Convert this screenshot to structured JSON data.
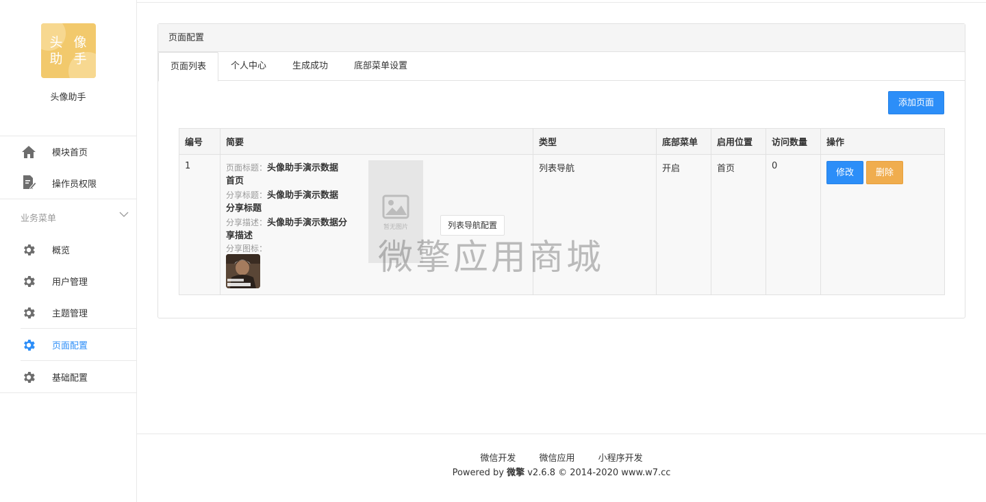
{
  "sidebar": {
    "logo_line1": "头 像",
    "logo_line2": "助 手",
    "app_name": "头像助手",
    "top_items": [
      {
        "label": "模块首页",
        "icon": "home-icon"
      },
      {
        "label": "操作员权限",
        "icon": "document-edit-icon"
      }
    ],
    "group_title": "业务菜单",
    "group_items": [
      {
        "label": "概览",
        "icon": "gear-icon"
      },
      {
        "label": "用户管理",
        "icon": "gear-icon"
      },
      {
        "label": "主题管理",
        "icon": "gear-icon"
      },
      {
        "label": "页面配置",
        "icon": "gear-icon",
        "active": true
      },
      {
        "label": "基础配置",
        "icon": "gear-icon"
      }
    ]
  },
  "panel": {
    "title": "页面配置",
    "tabs": [
      "页面列表",
      "个人中心",
      "生成成功",
      "底部菜单设置"
    ],
    "active_tab": 0,
    "add_button": "添加页面"
  },
  "table": {
    "headers": [
      "编号",
      "简要",
      "类型",
      "底部菜单",
      "启用位置",
      "访问数量",
      "操作"
    ],
    "rows": [
      {
        "id": "1",
        "summary": {
          "page_title_key": "页面标题：",
          "page_title_val1": "头像助手演示数据",
          "page_title_val2": "首页",
          "share_title_key": "分享标题：",
          "share_title_val1": "头像助手演示数据",
          "share_title_val2": "分享标题",
          "share_desc_key": "分享描述：",
          "share_desc_val1": "头像助手演示数据分",
          "share_desc_val2": "享描述",
          "share_icon_key": "分享图标：",
          "no_image_caption": "暂无图片",
          "list_nav_button": "列表导航配置"
        },
        "type": "列表导航",
        "bottom_menu": "开启",
        "position": "首页",
        "visits": "0",
        "edit_label": "修改",
        "delete_label": "删除"
      }
    ]
  },
  "watermark": "微擎应用商城",
  "footer": {
    "links": [
      "微信开发",
      "微信应用",
      "小程序开发"
    ],
    "powered_prefix": "Powered by ",
    "powered_brand": "微擎",
    "powered_suffix": " v2.6.8 © 2014-2020 www.w7.cc"
  },
  "colors": {
    "primary": "#2c8ef8",
    "warning": "#f0ad4e",
    "logo_bg": "#f2c96c",
    "icon_gray": "#6d6d6d"
  }
}
